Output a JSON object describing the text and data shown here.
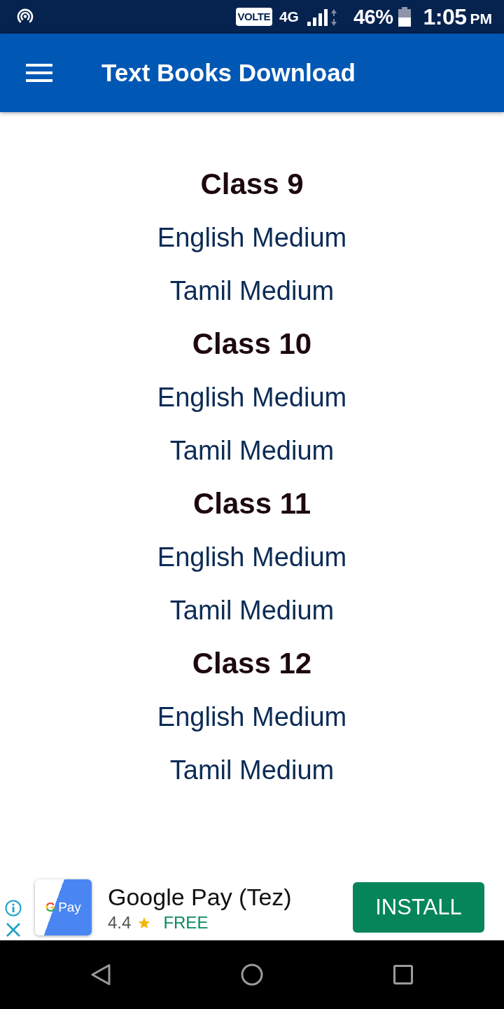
{
  "status_bar": {
    "network_badge": "VOLTE",
    "network_type": "4G",
    "battery": "46%",
    "time": "1:05",
    "time_suffix": "PM"
  },
  "app_bar": {
    "title": "Text Books Download"
  },
  "sections": [
    {
      "title": "Class 9",
      "links": [
        "English Medium",
        "Tamil Medium"
      ]
    },
    {
      "title": "Class 10",
      "links": [
        "English Medium",
        "Tamil Medium"
      ]
    },
    {
      "title": "Class 11",
      "links": [
        "English Medium",
        "Tamil Medium"
      ]
    },
    {
      "title": "Class 12",
      "links": [
        "English Medium",
        "Tamil Medium"
      ]
    }
  ],
  "ad": {
    "icon_letter": "G",
    "icon_word": "Pay",
    "app_name": "Google Pay (Tez)",
    "rating": "4.4",
    "price": "FREE",
    "button": "INSTALL"
  }
}
